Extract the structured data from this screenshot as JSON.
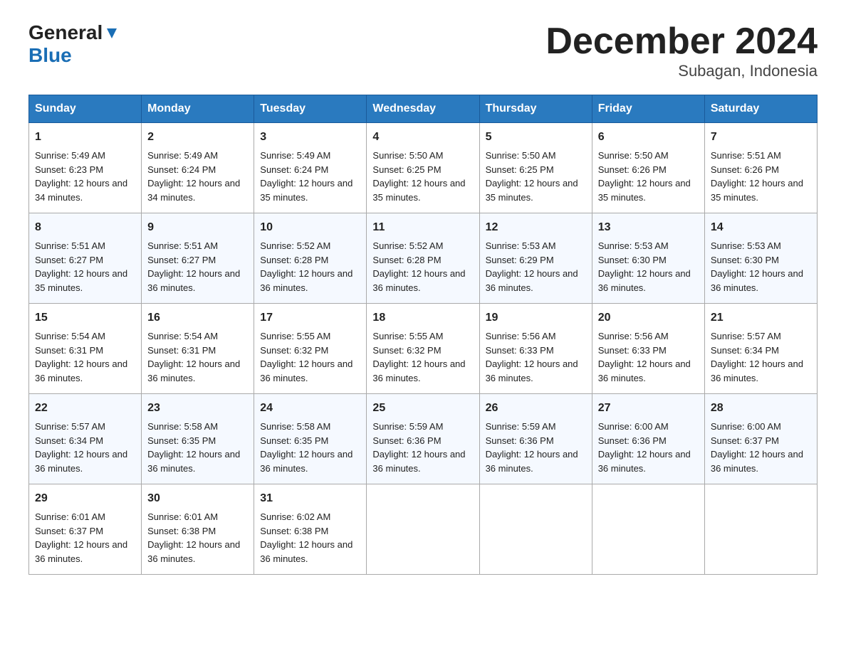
{
  "header": {
    "logo_general": "General",
    "logo_blue": "Blue",
    "title": "December 2024",
    "subtitle": "Subagan, Indonesia"
  },
  "days_of_week": [
    "Sunday",
    "Monday",
    "Tuesday",
    "Wednesday",
    "Thursday",
    "Friday",
    "Saturday"
  ],
  "weeks": [
    [
      {
        "day": "1",
        "sunrise": "5:49 AM",
        "sunset": "6:23 PM",
        "daylight": "12 hours and 34 minutes."
      },
      {
        "day": "2",
        "sunrise": "5:49 AM",
        "sunset": "6:24 PM",
        "daylight": "12 hours and 34 minutes."
      },
      {
        "day": "3",
        "sunrise": "5:49 AM",
        "sunset": "6:24 PM",
        "daylight": "12 hours and 35 minutes."
      },
      {
        "day": "4",
        "sunrise": "5:50 AM",
        "sunset": "6:25 PM",
        "daylight": "12 hours and 35 minutes."
      },
      {
        "day": "5",
        "sunrise": "5:50 AM",
        "sunset": "6:25 PM",
        "daylight": "12 hours and 35 minutes."
      },
      {
        "day": "6",
        "sunrise": "5:50 AM",
        "sunset": "6:26 PM",
        "daylight": "12 hours and 35 minutes."
      },
      {
        "day": "7",
        "sunrise": "5:51 AM",
        "sunset": "6:26 PM",
        "daylight": "12 hours and 35 minutes."
      }
    ],
    [
      {
        "day": "8",
        "sunrise": "5:51 AM",
        "sunset": "6:27 PM",
        "daylight": "12 hours and 35 minutes."
      },
      {
        "day": "9",
        "sunrise": "5:51 AM",
        "sunset": "6:27 PM",
        "daylight": "12 hours and 36 minutes."
      },
      {
        "day": "10",
        "sunrise": "5:52 AM",
        "sunset": "6:28 PM",
        "daylight": "12 hours and 36 minutes."
      },
      {
        "day": "11",
        "sunrise": "5:52 AM",
        "sunset": "6:28 PM",
        "daylight": "12 hours and 36 minutes."
      },
      {
        "day": "12",
        "sunrise": "5:53 AM",
        "sunset": "6:29 PM",
        "daylight": "12 hours and 36 minutes."
      },
      {
        "day": "13",
        "sunrise": "5:53 AM",
        "sunset": "6:30 PM",
        "daylight": "12 hours and 36 minutes."
      },
      {
        "day": "14",
        "sunrise": "5:53 AM",
        "sunset": "6:30 PM",
        "daylight": "12 hours and 36 minutes."
      }
    ],
    [
      {
        "day": "15",
        "sunrise": "5:54 AM",
        "sunset": "6:31 PM",
        "daylight": "12 hours and 36 minutes."
      },
      {
        "day": "16",
        "sunrise": "5:54 AM",
        "sunset": "6:31 PM",
        "daylight": "12 hours and 36 minutes."
      },
      {
        "day": "17",
        "sunrise": "5:55 AM",
        "sunset": "6:32 PM",
        "daylight": "12 hours and 36 minutes."
      },
      {
        "day": "18",
        "sunrise": "5:55 AM",
        "sunset": "6:32 PM",
        "daylight": "12 hours and 36 minutes."
      },
      {
        "day": "19",
        "sunrise": "5:56 AM",
        "sunset": "6:33 PM",
        "daylight": "12 hours and 36 minutes."
      },
      {
        "day": "20",
        "sunrise": "5:56 AM",
        "sunset": "6:33 PM",
        "daylight": "12 hours and 36 minutes."
      },
      {
        "day": "21",
        "sunrise": "5:57 AM",
        "sunset": "6:34 PM",
        "daylight": "12 hours and 36 minutes."
      }
    ],
    [
      {
        "day": "22",
        "sunrise": "5:57 AM",
        "sunset": "6:34 PM",
        "daylight": "12 hours and 36 minutes."
      },
      {
        "day": "23",
        "sunrise": "5:58 AM",
        "sunset": "6:35 PM",
        "daylight": "12 hours and 36 minutes."
      },
      {
        "day": "24",
        "sunrise": "5:58 AM",
        "sunset": "6:35 PM",
        "daylight": "12 hours and 36 minutes."
      },
      {
        "day": "25",
        "sunrise": "5:59 AM",
        "sunset": "6:36 PM",
        "daylight": "12 hours and 36 minutes."
      },
      {
        "day": "26",
        "sunrise": "5:59 AM",
        "sunset": "6:36 PM",
        "daylight": "12 hours and 36 minutes."
      },
      {
        "day": "27",
        "sunrise": "6:00 AM",
        "sunset": "6:36 PM",
        "daylight": "12 hours and 36 minutes."
      },
      {
        "day": "28",
        "sunrise": "6:00 AM",
        "sunset": "6:37 PM",
        "daylight": "12 hours and 36 minutes."
      }
    ],
    [
      {
        "day": "29",
        "sunrise": "6:01 AM",
        "sunset": "6:37 PM",
        "daylight": "12 hours and 36 minutes."
      },
      {
        "day": "30",
        "sunrise": "6:01 AM",
        "sunset": "6:38 PM",
        "daylight": "12 hours and 36 minutes."
      },
      {
        "day": "31",
        "sunrise": "6:02 AM",
        "sunset": "6:38 PM",
        "daylight": "12 hours and 36 minutes."
      },
      null,
      null,
      null,
      null
    ]
  ],
  "labels": {
    "sunrise": "Sunrise:",
    "sunset": "Sunset:",
    "daylight": "Daylight:"
  }
}
